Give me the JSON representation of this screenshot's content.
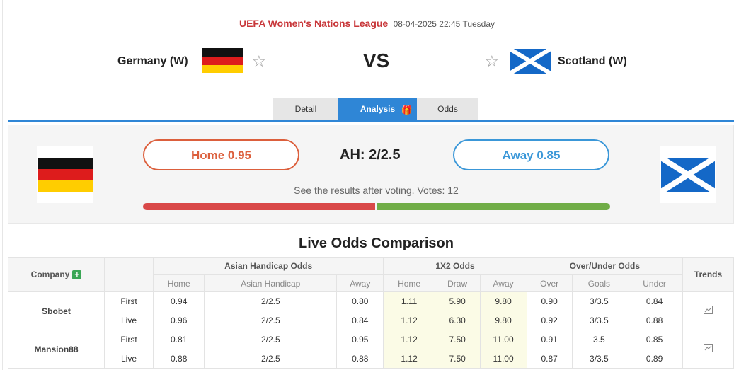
{
  "match": {
    "league": "UEFA Women's Nations League",
    "datetime": "08-04-2025 22:45 Tuesday",
    "home_team": "Germany (W)",
    "away_team": "Scotland (W)",
    "vs": "VS"
  },
  "tabs": [
    {
      "label": "Detail"
    },
    {
      "label": "Analysis"
    },
    {
      "label": "Odds"
    }
  ],
  "vote": {
    "home_label": "Home 0.95",
    "away_label": "Away 0.85",
    "ah": "AH: 2/2.5",
    "note": "See the results after voting. Votes: 12",
    "home_share": 0.5,
    "away_share": 0.5,
    "home_color": "#d94848",
    "away_color": "#70ad47"
  },
  "odds": {
    "title": "Live Odds Comparison",
    "headers": {
      "company": "Company",
      "asian": "Asian Handicap Odds",
      "x12": "1X2 Odds",
      "ou": "Over/Under Odds",
      "trends": "Trends"
    },
    "sub_headers": {
      "asian": [
        "Home",
        "Asian Handicap",
        "Away"
      ],
      "x12": [
        "Home",
        "Draw",
        "Away"
      ],
      "ou": [
        "Over",
        "Goals",
        "Under"
      ]
    },
    "rows": [
      {
        "company": "Sbobet",
        "type": "First",
        "ah": [
          "0.94",
          "2/2.5",
          "0.80"
        ],
        "x12": [
          "1.11",
          "5.90",
          "9.80"
        ],
        "ou": [
          "0.90",
          "3/3.5",
          "0.84"
        ]
      },
      {
        "company": "Sbobet",
        "type": "Live",
        "ah": [
          "0.96",
          "2/2.5",
          "0.84"
        ],
        "x12": [
          "1.12",
          "6.30",
          "9.80"
        ],
        "ou": [
          "0.92",
          "3/3.5",
          "0.88"
        ]
      },
      {
        "company": "Mansion88",
        "type": "First",
        "ah": [
          "0.81",
          "2/2.5",
          "0.95"
        ],
        "x12": [
          "1.12",
          "7.50",
          "11.00"
        ],
        "ou": [
          "0.91",
          "3.5",
          "0.85"
        ]
      },
      {
        "company": "Mansion88",
        "type": "Live",
        "ah": [
          "0.88",
          "2/2.5",
          "0.88"
        ],
        "x12": [
          "1.12",
          "7.50",
          "11.00"
        ],
        "ou": [
          "0.87",
          "3/3.5",
          "0.89"
        ]
      }
    ]
  },
  "colors": {
    "league": "#c8373a",
    "tab_active": "#2f86d6",
    "home_accent": "#dc5f3c",
    "away_accent": "#3a97d8"
  }
}
